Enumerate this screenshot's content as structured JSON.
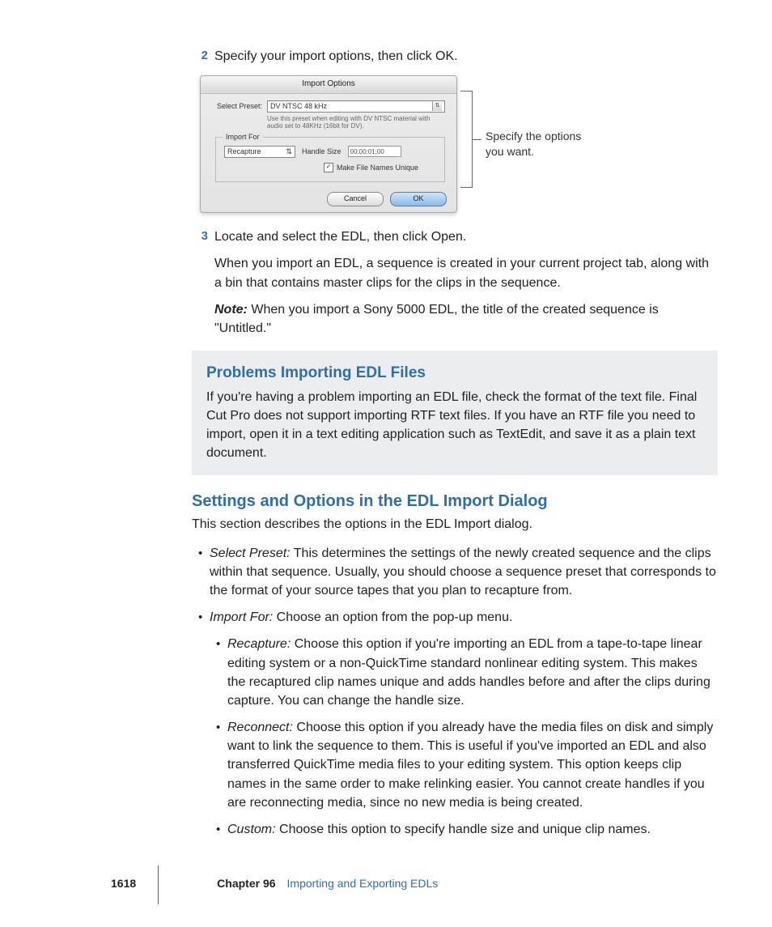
{
  "step2": {
    "num": "2",
    "text": "Specify your import options, then click OK."
  },
  "dialog": {
    "title": "Import Options",
    "select_preset_label": "Select Preset:",
    "select_preset_value": "DV NTSC 48 kHz",
    "preset_hint": "Use this preset when editing with DV NTSC material with audio set to 48KHz (16bit for DV).",
    "import_for_label": "Import For",
    "import_for_value": "Recapture",
    "handle_size_label": "Handle Size",
    "handle_size_value": "00:00:01;00",
    "unique_label": "Make File Names Unique",
    "cancel": "Cancel",
    "ok": "OK"
  },
  "callout": "Specify the options you want.",
  "step3": {
    "num": "3",
    "text": "Locate and select the EDL, then click Open.",
    "after": "When you import an EDL, a sequence is created in your current project tab, along with a bin that contains master clips for the clips in the sequence.",
    "note_label": "Note:",
    "note": "  When you import a Sony 5000 EDL, the title of the created sequence is \"Untitled.\""
  },
  "infobox": {
    "heading": "Problems Importing EDL Files",
    "body": "If you're having a problem importing an EDL file, check the format of the text file. Final Cut Pro does not support importing RTF text files. If you have an RTF file you need to import, open it in a text editing application such as TextEdit, and save it as a plain text document."
  },
  "section": {
    "heading": "Settings and Options in the EDL Import Dialog",
    "desc": "This section describes the options in the EDL Import dialog.",
    "items": [
      {
        "term": "Select Preset:",
        "body": "  This determines the settings of the newly created sequence and the clips within that sequence. Usually, you should choose a sequence preset that corresponds to the format of your source tapes that you plan to recapture from."
      },
      {
        "term": "Import For:",
        "body": "  Choose an option from the pop-up menu."
      }
    ],
    "sub": [
      {
        "term": "Recapture:",
        "body": "  Choose this option if you're importing an EDL from a tape-to-tape linear editing system or a non-QuickTime standard nonlinear editing system. This makes the recaptured clip names unique and adds handles before and after the clips during capture. You can change the handle size."
      },
      {
        "term": "Reconnect:",
        "body": "  Choose this option if you already have the media files on disk and simply want to link the sequence to them. This is useful if you've imported an EDL and also transferred QuickTime media files to your editing system. This option keeps clip names in the same order to make relinking easier. You cannot create handles if you are reconnecting media, since no new media is being created."
      },
      {
        "term": "Custom:",
        "body": "  Choose this option to specify handle size and unique clip names."
      }
    ]
  },
  "footer": {
    "page": "1618",
    "chapter_label": "Chapter 96",
    "chapter_title": "Importing and Exporting EDLs"
  }
}
